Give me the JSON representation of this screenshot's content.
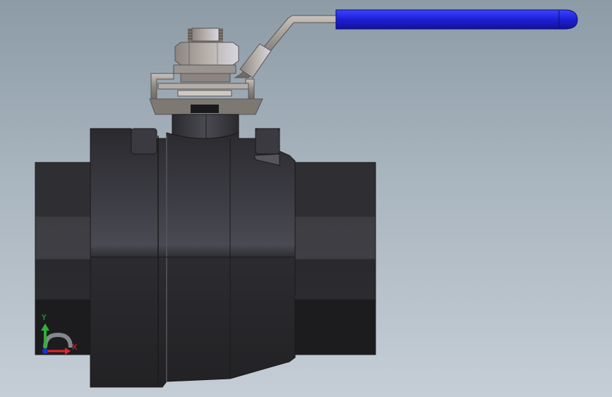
{
  "triad": {
    "x_label": "X",
    "y_label": "Y",
    "x_color": "#e8212b",
    "y_color": "#2fb13a",
    "z_color": "#1a2fd6"
  },
  "colors": {
    "background_top": "#8c9ba6",
    "background_bottom": "#c5ced6",
    "body": "#2e2e32",
    "handle_grip": "#1d1fd4",
    "steel": "#9a9490"
  }
}
